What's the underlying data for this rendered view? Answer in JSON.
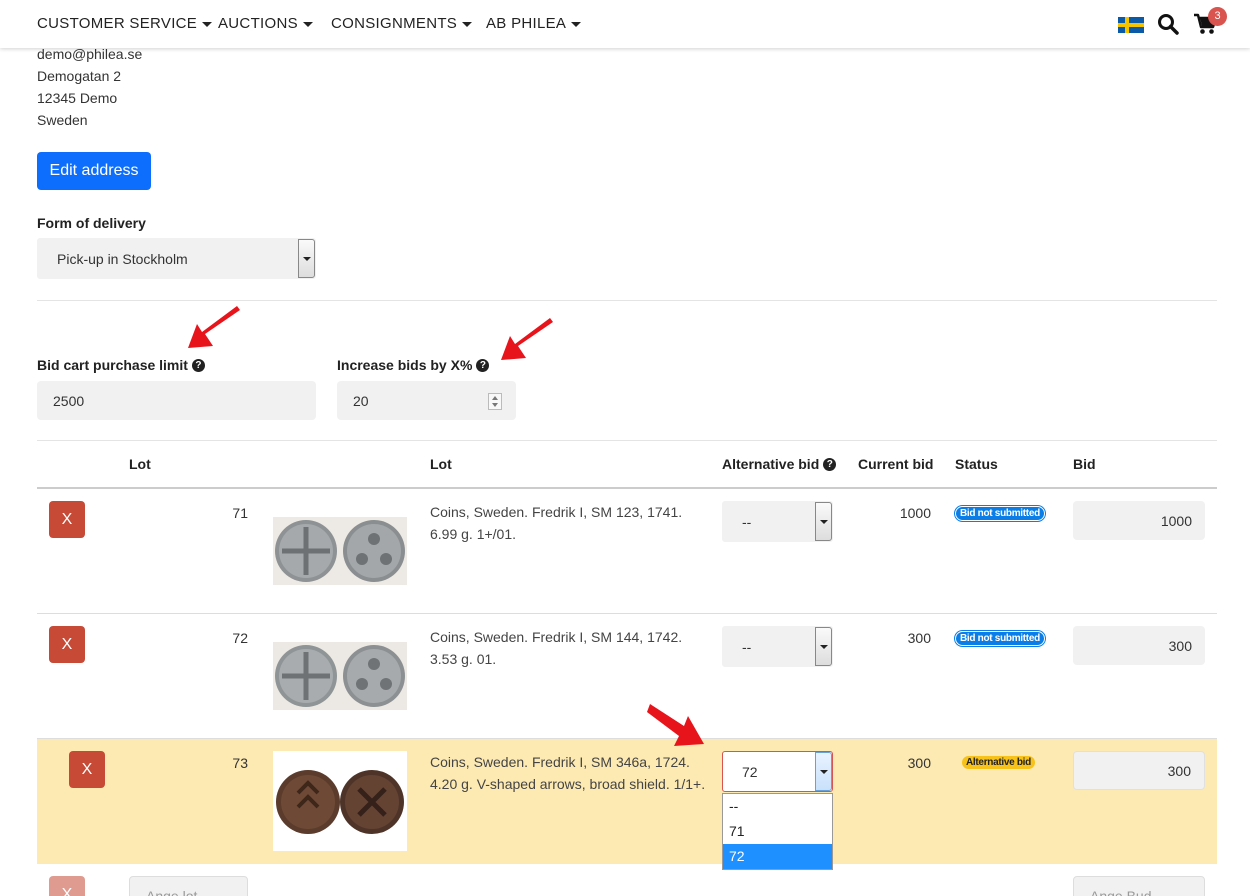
{
  "nav": {
    "items": [
      "CUSTOMER SERVICE",
      "AUCTIONS",
      "CONSIGNMENTS",
      "AB PHILEA"
    ],
    "cart_count": "3",
    "flag_icon": "sweden-flag-icon"
  },
  "address": {
    "email": "demo@philea.se",
    "street": "Demogatan 2",
    "city": "12345 Demo",
    "country": "Sweden",
    "edit_label": "Edit address"
  },
  "delivery": {
    "label": "Form of delivery",
    "value": "Pick-up in Stockholm"
  },
  "limit": {
    "label": "Bid cart purchase limit",
    "value": "2500"
  },
  "increase": {
    "label": "Increase bids by X%",
    "value": "20"
  },
  "table": {
    "headers": {
      "lot": "Lot",
      "lot_desc": "Lot",
      "alt_bid": "Alternative bid",
      "current_bid": "Current bid",
      "status": "Status",
      "bid": "Bid"
    },
    "rows": [
      {
        "remove": "X",
        "lot": "71",
        "desc1": "Coins, Sweden. Fredrik I, SM 123, 1741.",
        "desc2": "6.99 g. 1+/01.",
        "alt_bid": "--",
        "current_bid": "1000",
        "status": "Bid not submitted",
        "bid": "1000"
      },
      {
        "remove": "X",
        "lot": "72",
        "desc1": "Coins, Sweden. Fredrik I, SM 144, 1742.",
        "desc2": "3.53 g. 01.",
        "alt_bid": "--",
        "current_bid": "300",
        "status": "Bid not submitted",
        "bid": "300"
      },
      {
        "remove": "X",
        "lot": "73",
        "desc1": "Coins, Sweden. Fredrik I, SM 346a, 1724.",
        "desc2": "4.20 g. V-shaped arrows, broad shield. 1/1+.",
        "alt_bid": "72",
        "current_bid": "300",
        "status": "Alternative bid",
        "bid": "300"
      }
    ],
    "dropdown_options": [
      "--",
      "71",
      "72"
    ],
    "new_row": {
      "remove": "X",
      "lot_placeholder": "Ange lot",
      "bid_placeholder": "Ange Bud"
    }
  },
  "colors": {
    "primary": "#0d6efd",
    "danger": "#c64a36",
    "highlight_row": "#fdeab3",
    "status_blue": "#0a7ee6",
    "status_yellow": "#f7c21a",
    "annotation_arrow": "#e8141b"
  }
}
